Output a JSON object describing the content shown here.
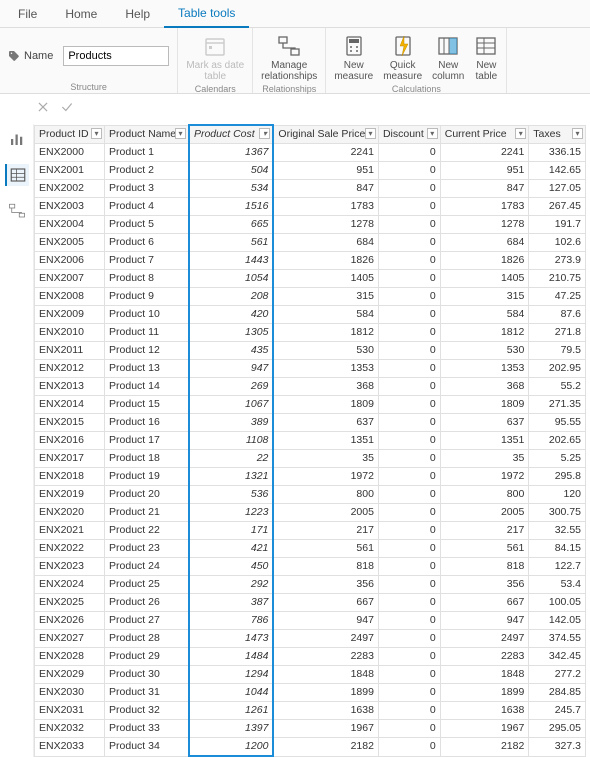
{
  "ribbon": {
    "tabs": [
      "File",
      "Home",
      "Help",
      "Table tools"
    ],
    "active_tab": "Table tools",
    "name_label": "Name",
    "name_value": "Products",
    "groups": {
      "structure": "Structure",
      "calendars": "Calendars",
      "relationships": "Relationships",
      "calculations": "Calculations"
    },
    "buttons": {
      "mark_as_date": "Mark as date\ntable",
      "manage_rel": "Manage\nrelationships",
      "new_measure": "New\nmeasure",
      "quick_measure": "Quick\nmeasure",
      "new_column": "New\ncolumn",
      "new_table": "New\ntable"
    }
  },
  "table": {
    "columns": [
      {
        "key": "id",
        "label": "Product ID",
        "align": "left"
      },
      {
        "key": "name",
        "label": "Product Name",
        "align": "left"
      },
      {
        "key": "cost",
        "label": "Product Cost",
        "align": "right",
        "selected": true
      },
      {
        "key": "orig",
        "label": "Original Sale Price",
        "align": "right"
      },
      {
        "key": "disc",
        "label": "Discount",
        "align": "right"
      },
      {
        "key": "curr",
        "label": "Current Price",
        "align": "right"
      },
      {
        "key": "tax",
        "label": "Taxes",
        "align": "right"
      }
    ],
    "rows": [
      {
        "id": "ENX2000",
        "name": "Product 1",
        "cost": 1367,
        "orig": 2241,
        "disc": 0,
        "curr": 2241,
        "tax": 336.15
      },
      {
        "id": "ENX2001",
        "name": "Product 2",
        "cost": 504,
        "orig": 951,
        "disc": 0,
        "curr": 951,
        "tax": 142.65
      },
      {
        "id": "ENX2002",
        "name": "Product 3",
        "cost": 534,
        "orig": 847,
        "disc": 0,
        "curr": 847,
        "tax": 127.05
      },
      {
        "id": "ENX2003",
        "name": "Product 4",
        "cost": 1516,
        "orig": 1783,
        "disc": 0,
        "curr": 1783,
        "tax": 267.45
      },
      {
        "id": "ENX2004",
        "name": "Product 5",
        "cost": 665,
        "orig": 1278,
        "disc": 0,
        "curr": 1278,
        "tax": 191.7
      },
      {
        "id": "ENX2005",
        "name": "Product 6",
        "cost": 561,
        "orig": 684,
        "disc": 0,
        "curr": 684,
        "tax": 102.6
      },
      {
        "id": "ENX2006",
        "name": "Product 7",
        "cost": 1443,
        "orig": 1826,
        "disc": 0,
        "curr": 1826,
        "tax": 273.9
      },
      {
        "id": "ENX2007",
        "name": "Product 8",
        "cost": 1054,
        "orig": 1405,
        "disc": 0,
        "curr": 1405,
        "tax": 210.75
      },
      {
        "id": "ENX2008",
        "name": "Product 9",
        "cost": 208,
        "orig": 315,
        "disc": 0,
        "curr": 315,
        "tax": 47.25
      },
      {
        "id": "ENX2009",
        "name": "Product 10",
        "cost": 420,
        "orig": 584,
        "disc": 0,
        "curr": 584,
        "tax": 87.6
      },
      {
        "id": "ENX2010",
        "name": "Product 11",
        "cost": 1305,
        "orig": 1812,
        "disc": 0,
        "curr": 1812,
        "tax": 271.8
      },
      {
        "id": "ENX2011",
        "name": "Product 12",
        "cost": 435,
        "orig": 530,
        "disc": 0,
        "curr": 530,
        "tax": 79.5
      },
      {
        "id": "ENX2012",
        "name": "Product 13",
        "cost": 947,
        "orig": 1353,
        "disc": 0,
        "curr": 1353,
        "tax": 202.95
      },
      {
        "id": "ENX2013",
        "name": "Product 14",
        "cost": 269,
        "orig": 368,
        "disc": 0,
        "curr": 368,
        "tax": 55.2
      },
      {
        "id": "ENX2014",
        "name": "Product 15",
        "cost": 1067,
        "orig": 1809,
        "disc": 0,
        "curr": 1809,
        "tax": 271.35
      },
      {
        "id": "ENX2015",
        "name": "Product 16",
        "cost": 389,
        "orig": 637,
        "disc": 0,
        "curr": 637,
        "tax": 95.55
      },
      {
        "id": "ENX2016",
        "name": "Product 17",
        "cost": 1108,
        "orig": 1351,
        "disc": 0,
        "curr": 1351,
        "tax": 202.65
      },
      {
        "id": "ENX2017",
        "name": "Product 18",
        "cost": 22,
        "orig": 35,
        "disc": 0,
        "curr": 35,
        "tax": 5.25
      },
      {
        "id": "ENX2018",
        "name": "Product 19",
        "cost": 1321,
        "orig": 1972,
        "disc": 0,
        "curr": 1972,
        "tax": 295.8
      },
      {
        "id": "ENX2019",
        "name": "Product 20",
        "cost": 536,
        "orig": 800,
        "disc": 0,
        "curr": 800,
        "tax": 120
      },
      {
        "id": "ENX2020",
        "name": "Product 21",
        "cost": 1223,
        "orig": 2005,
        "disc": 0,
        "curr": 2005,
        "tax": 300.75
      },
      {
        "id": "ENX2021",
        "name": "Product 22",
        "cost": 171,
        "orig": 217,
        "disc": 0,
        "curr": 217,
        "tax": 32.55
      },
      {
        "id": "ENX2022",
        "name": "Product 23",
        "cost": 421,
        "orig": 561,
        "disc": 0,
        "curr": 561,
        "tax": 84.15
      },
      {
        "id": "ENX2023",
        "name": "Product 24",
        "cost": 450,
        "orig": 818,
        "disc": 0,
        "curr": 818,
        "tax": 122.7
      },
      {
        "id": "ENX2024",
        "name": "Product 25",
        "cost": 292,
        "orig": 356,
        "disc": 0,
        "curr": 356,
        "tax": 53.4
      },
      {
        "id": "ENX2025",
        "name": "Product 26",
        "cost": 387,
        "orig": 667,
        "disc": 0,
        "curr": 667,
        "tax": 100.05
      },
      {
        "id": "ENX2026",
        "name": "Product 27",
        "cost": 786,
        "orig": 947,
        "disc": 0,
        "curr": 947,
        "tax": 142.05
      },
      {
        "id": "ENX2027",
        "name": "Product 28",
        "cost": 1473,
        "orig": 2497,
        "disc": 0,
        "curr": 2497,
        "tax": 374.55
      },
      {
        "id": "ENX2028",
        "name": "Product 29",
        "cost": 1484,
        "orig": 2283,
        "disc": 0,
        "curr": 2283,
        "tax": 342.45
      },
      {
        "id": "ENX2029",
        "name": "Product 30",
        "cost": 1294,
        "orig": 1848,
        "disc": 0,
        "curr": 1848,
        "tax": 277.2
      },
      {
        "id": "ENX2030",
        "name": "Product 31",
        "cost": 1044,
        "orig": 1899,
        "disc": 0,
        "curr": 1899,
        "tax": 284.85
      },
      {
        "id": "ENX2031",
        "name": "Product 32",
        "cost": 1261,
        "orig": 1638,
        "disc": 0,
        "curr": 1638,
        "tax": 245.7
      },
      {
        "id": "ENX2032",
        "name": "Product 33",
        "cost": 1397,
        "orig": 1967,
        "disc": 0,
        "curr": 1967,
        "tax": 295.05
      },
      {
        "id": "ENX2033",
        "name": "Product 34",
        "cost": 1200,
        "orig": 2182,
        "disc": 0,
        "curr": 2182,
        "tax": 327.3
      }
    ]
  }
}
